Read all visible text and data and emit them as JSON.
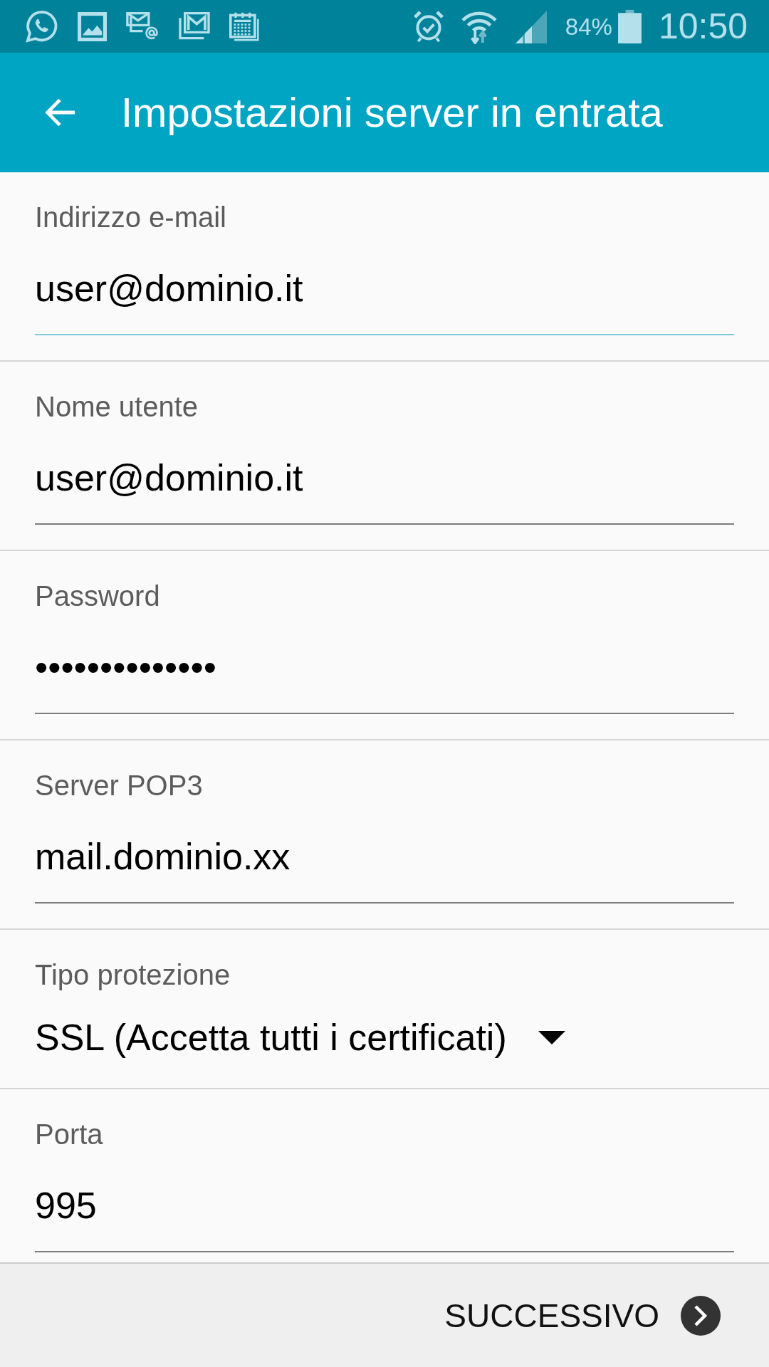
{
  "status_bar": {
    "battery": "84%",
    "time": "10:50"
  },
  "app_bar": {
    "title": "Impostazioni server in entrata"
  },
  "fields": [
    {
      "kind": "text",
      "label": "Indirizzo e-mail",
      "value": "user@dominio.it",
      "focused": true
    },
    {
      "kind": "text",
      "label": "Nome utente",
      "value": "user@dominio.it",
      "focused": false
    },
    {
      "kind": "text",
      "label": "Password",
      "value": "••••••••••••••",
      "focused": false
    },
    {
      "kind": "text",
      "label": "Server POP3",
      "value": "mail.dominio.xx",
      "focused": false
    },
    {
      "kind": "dropdown",
      "label": "Tipo protezione",
      "value": "SSL (Accetta tutti i certificati)",
      "focused": false
    },
    {
      "kind": "text",
      "label": "Porta",
      "value": "995",
      "focused": false
    }
  ],
  "footer": {
    "next_button": "SUCCESSIVO"
  }
}
